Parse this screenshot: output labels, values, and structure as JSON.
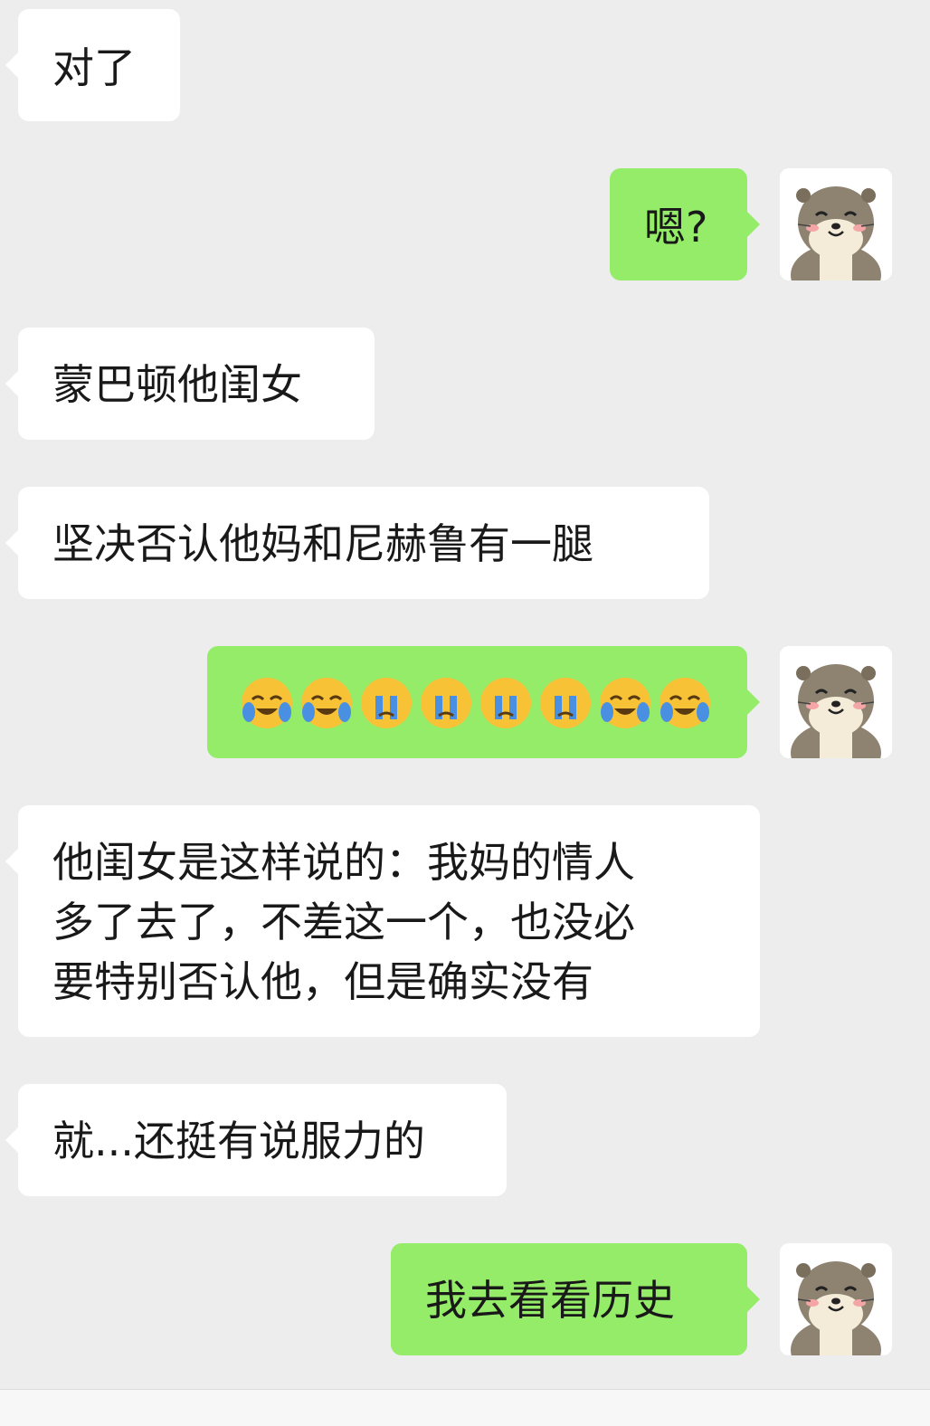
{
  "messages": [
    {
      "side": "in",
      "text": "对了"
    },
    {
      "side": "out",
      "text": "嗯?"
    },
    {
      "side": "in",
      "text": "蒙巴顿他闺女"
    },
    {
      "side": "in",
      "text": "坚决否认他妈和尼赫鲁有一腿"
    },
    {
      "side": "out",
      "text": "",
      "emojis": [
        "crying-laughing-emoji",
        "crying-laughing-emoji",
        "crying-emoji",
        "crying-emoji",
        "crying-emoji",
        "crying-emoji",
        "crying-laughing-emoji",
        "crying-laughing-emoji"
      ]
    },
    {
      "side": "in",
      "text": "他闺女是这样说的：我妈的情人\n多了去了，不差这一个，也没必\n要特别否认他，但是确实没有"
    },
    {
      "side": "in",
      "text": "就...还挺有说服力的"
    },
    {
      "side": "out",
      "text": "我去看看历史"
    }
  ],
  "colors": {
    "background": "#ededed",
    "incoming_bubble": "#ffffff",
    "outgoing_bubble": "#95ec69",
    "text": "#191919"
  },
  "avatar_icon": "otter-avatar-icon"
}
